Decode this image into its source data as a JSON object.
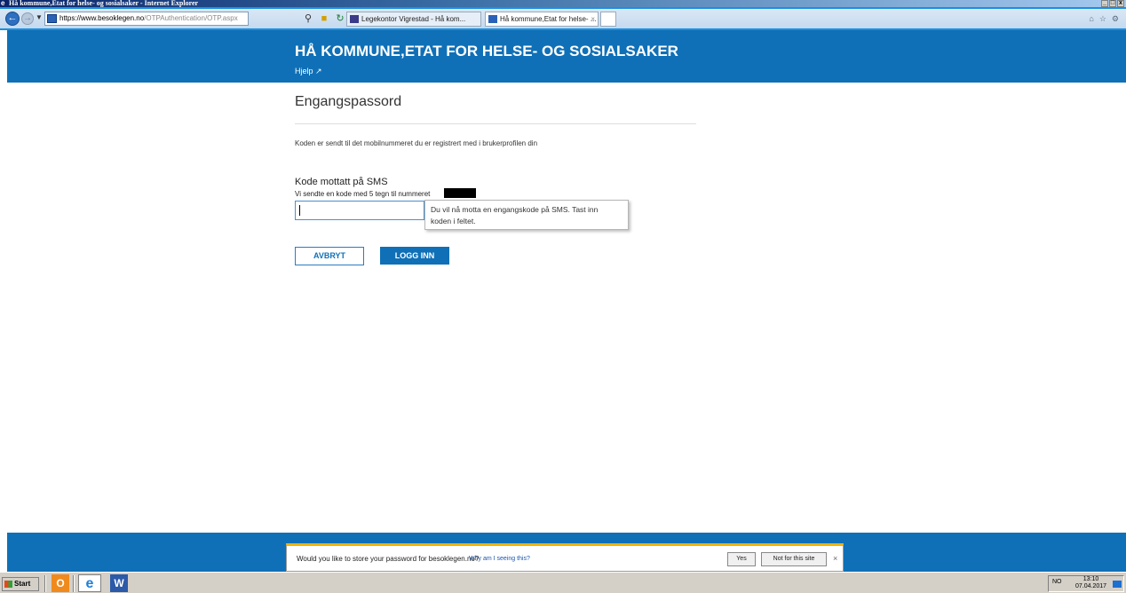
{
  "window": {
    "title": "Hå kommune,Etat for helse- og sosialsaker - Internet Explorer",
    "controls": [
      "_",
      "□",
      "x"
    ]
  },
  "browser": {
    "address_host": "https://www.besoklegen.no",
    "address_path": "/OTPAuthentication/OTP.aspx",
    "tabs": [
      {
        "label": "Legekontor Vigrestad - Hå kom..."
      },
      {
        "label": "Hå kommune,Etat for helse- ...",
        "close": "×"
      }
    ]
  },
  "page": {
    "header_title": "HÅ KOMMUNE,ETAT FOR HELSE- OG SOSIALSAKER",
    "help_label": "Hjelp ↗",
    "heading": "Engangspassord",
    "info_text": "Koden er sendt til det mobilnummeret du er registrert med i brukerprofilen din",
    "field_label": "Kode mottatt på SMS",
    "field_sub": "Vi sendte en kode med 5 tegn til nummeret",
    "code_value": "",
    "tooltip_line1": "Du vil nå motta en engangskode på SMS. Tast inn",
    "tooltip_line2": "koden i feltet.",
    "cancel_label": "AVBRYT",
    "login_label": "LOGG INN"
  },
  "password_prompt": {
    "question": "Would you like to store your password for besoklegen.no?",
    "why_link": "Why am I seeing this?",
    "yes_label": "Yes",
    "no_label": "Not for this site",
    "close": "×"
  },
  "taskbar": {
    "start_label": "Start",
    "language": "NO",
    "time": "13:10",
    "date": "07.04.2017"
  },
  "colors": {
    "brand_blue": "#0f70b7",
    "warning_bar": "#f0b400"
  }
}
